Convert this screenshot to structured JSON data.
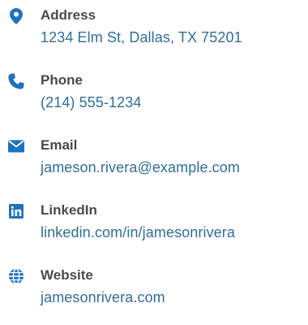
{
  "colors": {
    "accent": "#1e73be",
    "label": "#4a4a4a",
    "value": "#2f6f9c"
  },
  "contacts": [
    {
      "icon": "map-marker-icon",
      "label": "Address",
      "value": "1234 Elm St, Dallas, TX 75201"
    },
    {
      "icon": "phone-icon",
      "label": "Phone",
      "value": "(214) 555-1234"
    },
    {
      "icon": "envelope-icon",
      "label": "Email",
      "value": "jameson.rivera@example.com"
    },
    {
      "icon": "linkedin-icon",
      "label": "LinkedIn",
      "value": "linkedin.com/in/jamesonrivera"
    },
    {
      "icon": "globe-icon",
      "label": "Website",
      "value": "jamesonrivera.com"
    }
  ]
}
